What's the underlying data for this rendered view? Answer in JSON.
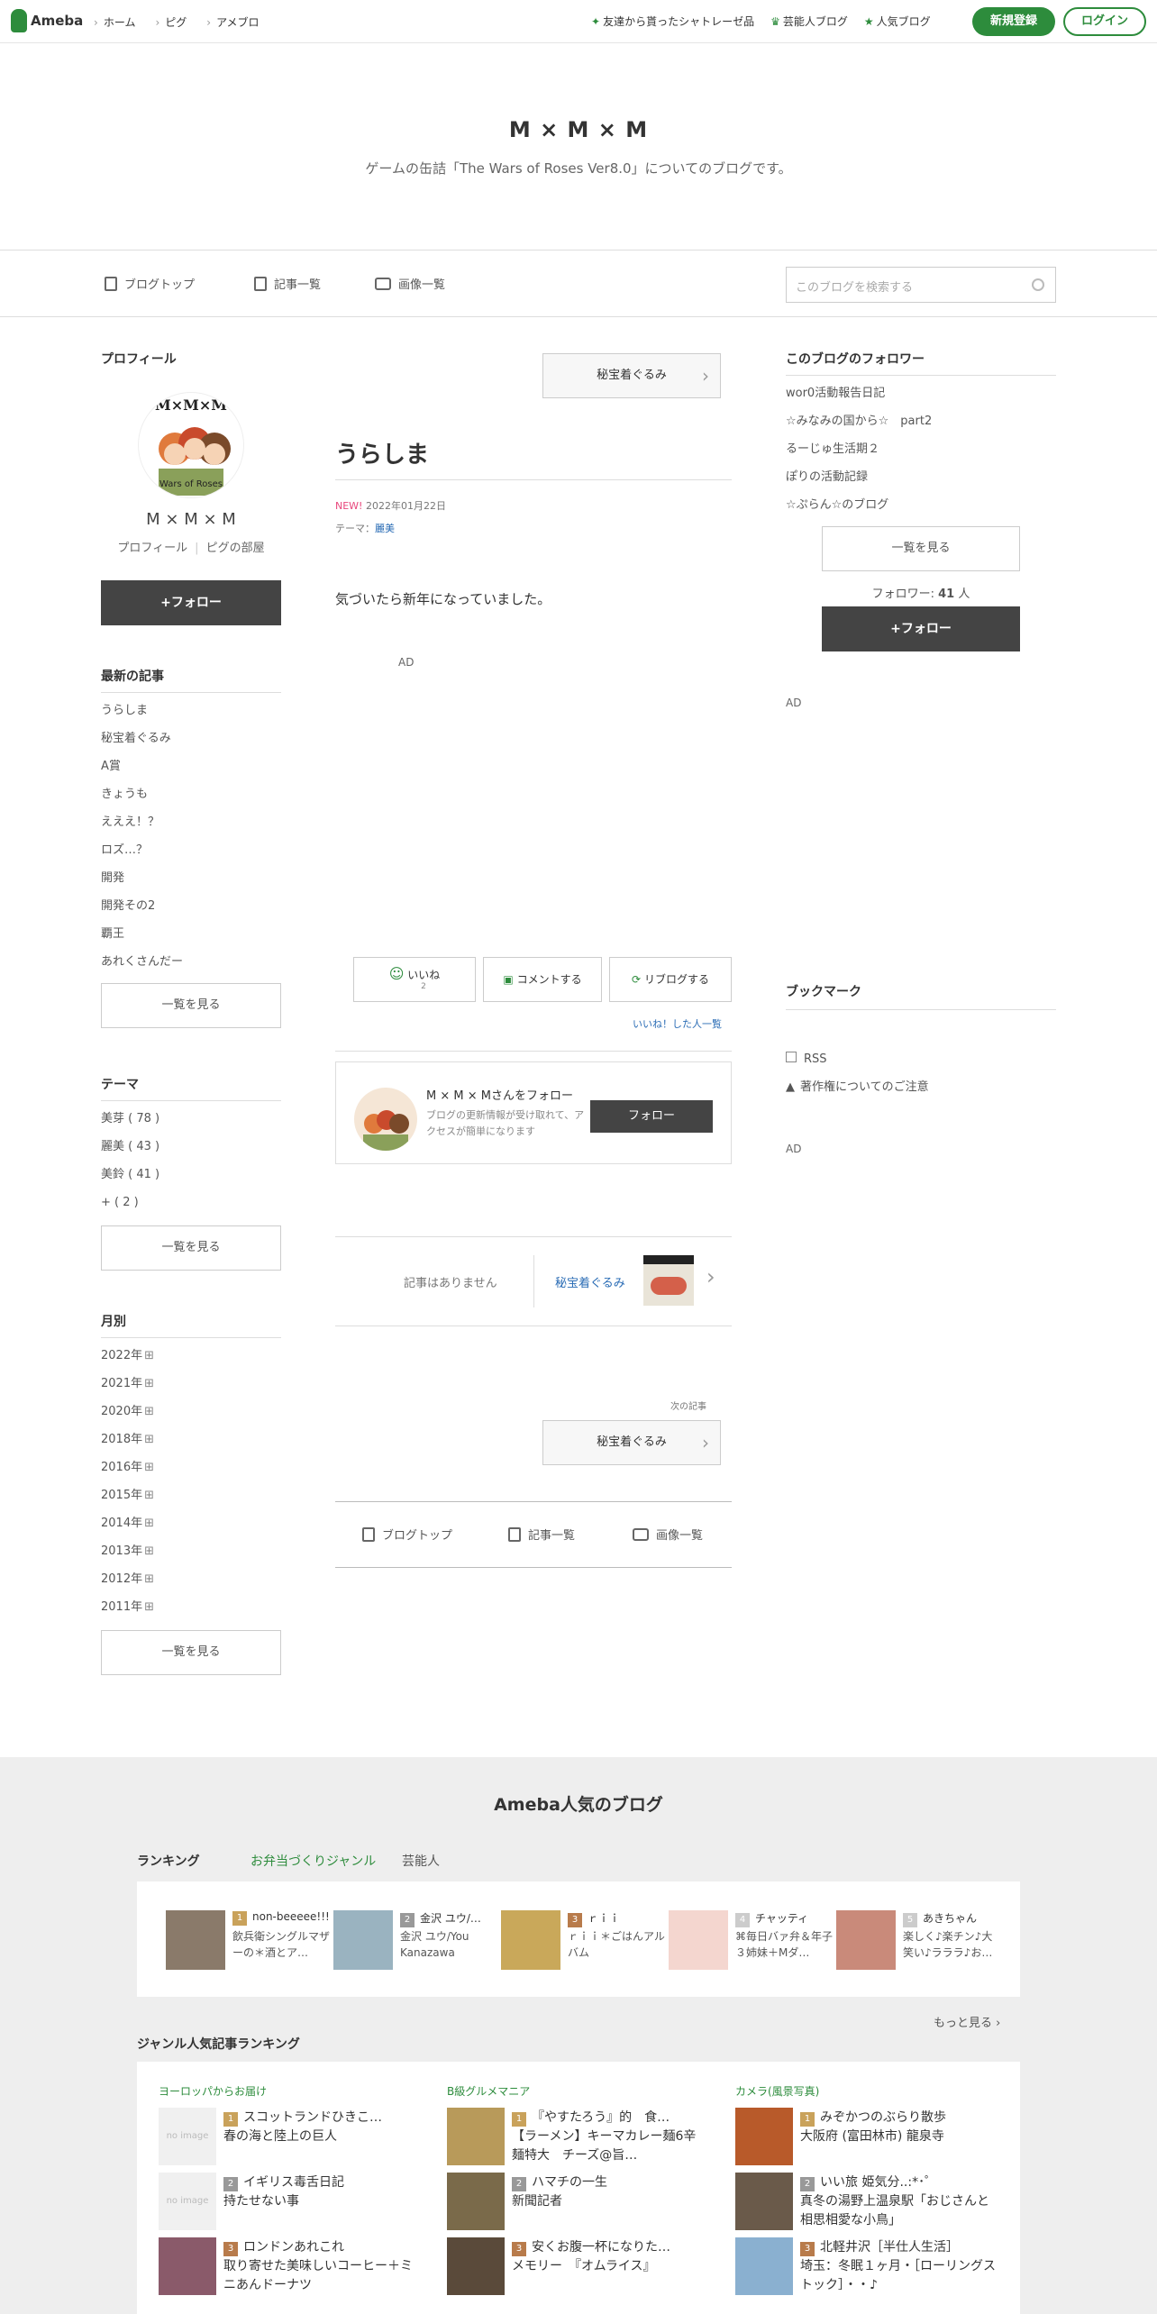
{
  "topbar": {
    "logo": "Ameba",
    "nav": [
      "ホーム",
      "ピグ",
      "アメブロ"
    ],
    "links": [
      "友達から貰ったシャトレーゼ品",
      "芸能人ブログ",
      "人気ブログ"
    ],
    "register": "新規登録",
    "login": "ログイン"
  },
  "header": {
    "title": "M × M × M",
    "description": "ゲームの缶詰「The Wars of Roses Ver8.0」についてのブログです。"
  },
  "subnav": {
    "items": [
      "ブログトップ",
      "記事一覧",
      "画像一覧"
    ],
    "search_placeholder": "このブログを検索する"
  },
  "left": {
    "profile_heading": "プロフィール",
    "logo_text": "M×M×M",
    "logo_sub": "Wars of Roses",
    "name": "M × M × M",
    "profile_link": "プロフィール",
    "pig_link": "ピグの部屋",
    "follow": "+フォロー",
    "recent_heading": "最新の記事",
    "recent": [
      "うらしま",
      "秘宝着ぐるみ",
      "A賞",
      "きょうも",
      "えええ！？",
      "ロズ…？",
      "開発",
      "開発その2",
      "覇王",
      "あれくさんだー"
    ],
    "recent_more": "一覧を見る",
    "theme_heading": "テーマ",
    "themes": [
      "美芽 ( 78 )",
      "麗美 ( 43 )",
      "美鈴 ( 41 )",
      "+ ( 2 )"
    ],
    "theme_more": "一覧を見る",
    "month_heading": "月別",
    "months": [
      "2022年",
      "2021年",
      "2020年",
      "2018年",
      "2016年",
      "2015年",
      "2014年",
      "2013年",
      "2012年",
      "2011年"
    ],
    "month_more": "一覧を見る"
  },
  "article": {
    "prev_label": "秘宝着ぐるみ",
    "title": "うらしま",
    "new_badge": "NEW!",
    "date": "2022年01月22日",
    "theme_prefix": "テーマ：",
    "theme": "麗美",
    "body": "気づいたら新年になっていました。",
    "ad": "AD",
    "like": "いいね",
    "like_count": "2",
    "comment": "コメントする",
    "reblog": "リブログする",
    "liked_list": "いいね！した人一覧",
    "follow_card_name": "M × M × Mさんをフォロー",
    "follow_card_desc": "ブログの更新情報が受け取れて、アクセスが簡単になります",
    "follow_card_btn": "フォロー",
    "no_article": "記事はありません",
    "next_article": "秘宝着ぐるみ",
    "next_heading": "次の記事",
    "next_label": "秘宝着ぐるみ",
    "bottom_nav": [
      "ブログトップ",
      "記事一覧",
      "画像一覧"
    ]
  },
  "right": {
    "followers_heading": "このブログのフォロワー",
    "followers": [
      "wor0活動報告日記",
      "☆みなみの国から☆　part2",
      "るーじゅ生活期２",
      "ぽりの活動記録",
      "☆ぷらん☆のブログ"
    ],
    "more": "一覧を見る",
    "count_label": "フォロワー: ",
    "count": "41",
    "count_unit": " 人",
    "follow": "+フォロー",
    "ad1": "AD",
    "bookmark_heading": "ブックマーク",
    "rss": "RSS",
    "copyright": "著作権についてのご注意",
    "ad2": "AD"
  },
  "footer": {
    "title": "Ameba人気のブログ",
    "tabs": [
      "ランキング",
      "お弁当づくりジャンル",
      "芸能人"
    ],
    "ranking": [
      {
        "rank": "1",
        "name": "non-beeeee!!!",
        "desc": "飲兵衛シングルマザーの＊酒とア…"
      },
      {
        "rank": "2",
        "name": "金沢 ユウ/…",
        "desc": "金沢 ユウ/You Kanazawa"
      },
      {
        "rank": "3",
        "name": "ｒｉｉ",
        "desc": "ｒｉｉ＊ごはんアルバム"
      },
      {
        "rank": "4",
        "name": "チャッティ",
        "desc": "⌘毎日バァ弁＆年子３姉妹＋Mダ…"
      },
      {
        "rank": "5",
        "name": "あきちゃん",
        "desc": "楽しく♪楽チン♪大笑い♪ラララ♪お…"
      }
    ],
    "more": "もっと見る",
    "genre_heading": "ジャンル人気記事ランキング",
    "genres": [
      {
        "title": "ヨーロッパからお届け",
        "items": [
          {
            "rank": "1",
            "name": "スコットランドひきこ…",
            "desc": "春の海と陸上の巨人",
            "thumb": "no image"
          },
          {
            "rank": "2",
            "name": "イギリス毒舌日記",
            "desc": "持たせない事",
            "thumb": "no image"
          },
          {
            "rank": "3",
            "name": "ロンドンあれこれ",
            "desc": "取り寄せた美味しいコーヒー＋ミニあんドーナツ",
            "thumb": ""
          }
        ]
      },
      {
        "title": "B級グルメマニア",
        "items": [
          {
            "rank": "1",
            "name": "『やすたろう』的　食…",
            "desc": "【ラーメン】キーマカレー麺6辛　麺特大　チーズ@旨…",
            "thumb": ""
          },
          {
            "rank": "2",
            "name": "ハマチの一生",
            "desc": "新聞記者",
            "thumb": ""
          },
          {
            "rank": "3",
            "name": "安くお腹一杯になりた…",
            "desc": "メモリー　『オムライス』",
            "thumb": ""
          }
        ]
      },
      {
        "title": "カメラ(風景写真)",
        "items": [
          {
            "rank": "1",
            "name": "みぞかつのぶらり散歩",
            "desc": "大阪府 (富田林市) 龍泉寺",
            "thumb": ""
          },
          {
            "rank": "2",
            "name": "いい旅 姫気分..:*･゜",
            "desc": "真冬の湯野上温泉駅「おじさんと相思相愛な小鳥」",
            "thumb": ""
          },
          {
            "rank": "3",
            "name": "北軽井沢［半仕人生活］",
            "desc": "埼玉：冬眠１ヶ月・［ローリングストック］・・♪",
            "thumb": ""
          }
        ]
      }
    ]
  }
}
